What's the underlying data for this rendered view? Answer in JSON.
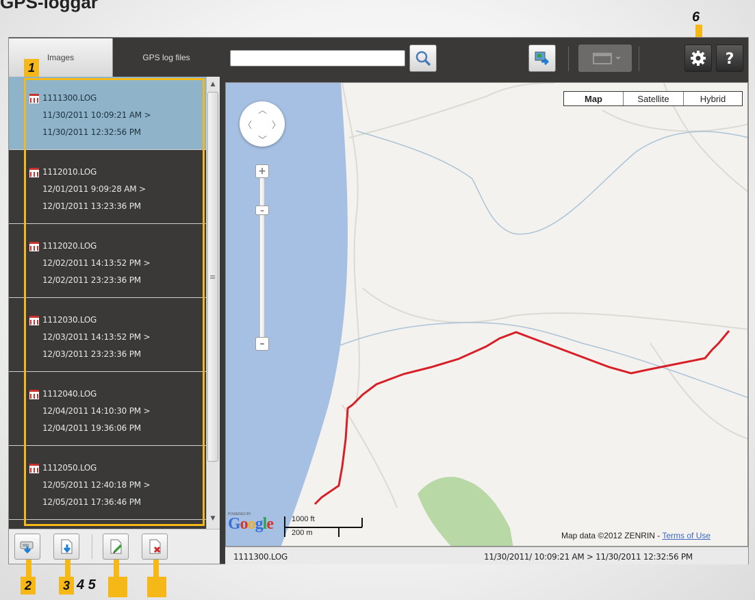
{
  "page": {
    "title": "GPS-loggar"
  },
  "tabs": [
    {
      "label": "Images"
    },
    {
      "label": "GPS log files"
    }
  ],
  "log_files": [
    {
      "name": "1111300.LOG",
      "start": "11/30/2011 10:09:21 AM >",
      "end": "11/30/2011 12:32:56 PM"
    },
    {
      "name": "1112010.LOG",
      "start": "12/01/2011 9:09:28 AM >",
      "end": "12/01/2011 13:23:36 PM"
    },
    {
      "name": "1112020.LOG",
      "start": "12/02/2011 14:13:52 PM >",
      "end": "12/02/2011 23:23:36 PM"
    },
    {
      "name": "1112030.LOG",
      "start": "12/03/2011 14:13:52 PM >",
      "end": "12/03/2011 23:23:36 PM"
    },
    {
      "name": "1112040.LOG",
      "start": "12/04/2011 14:10:30 PM >",
      "end": "12/04/2011 19:36:06 PM"
    },
    {
      "name": "1112050.LOG",
      "start": "12/05/2011 12:40:18 PM >",
      "end": "12/05/2011 17:36:46 PM"
    }
  ],
  "selected_log_index": 0,
  "toolbar": {
    "search_placeholder": ""
  },
  "map": {
    "types": [
      "Map",
      "Satellite",
      "Hybrid"
    ],
    "active_type": "Map",
    "powered_by": "POWERED BY",
    "logo": "Google",
    "scale_imperial": "1000 ft",
    "scale_metric": "200 m",
    "attribution": "Map data ©2012 ZENRIN - ",
    "terms_link": "Terms of Use"
  },
  "status_bar": {
    "file": "1111300.LOG",
    "range": "11/30/2011/ 10:09:21 AM > 11/30/2011 12:32:56 PM"
  },
  "callouts": {
    "c1": "1",
    "c2": "2",
    "c3": "3",
    "c45": "4 5",
    "c6": "6"
  },
  "colors": {
    "accent": "#f6b817",
    "selected_row": "#8fb3c8",
    "track": "#d61f26",
    "water": "#a6c0e3",
    "park": "#b8d8a6"
  }
}
